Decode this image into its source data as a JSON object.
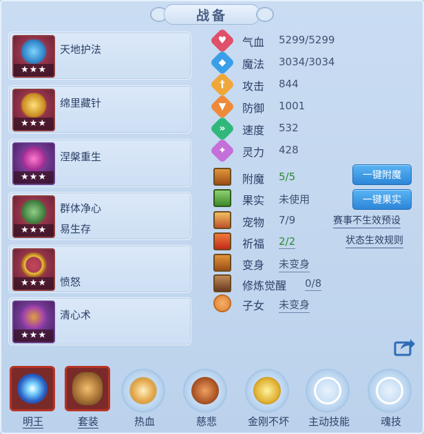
{
  "title": "战备",
  "skills": [
    {
      "name": "天地护法",
      "stars": "★★★",
      "icon": "dragon-icon",
      "color": "#3aa9e0"
    },
    {
      "name": "绵里藏针",
      "stars": "★★★",
      "icon": "treasure-icon",
      "color": "#d89a2a"
    },
    {
      "name": "涅槃重生",
      "stars": "★★★",
      "icon": "mask-icon",
      "color": "#c43aa0"
    },
    {
      "name": "群体净心",
      "name2": "易生存",
      "stars": "★★★",
      "icon": "beads-icon",
      "color": "#4d9a52"
    },
    {
      "name": "愤怒",
      "stars": "★★★",
      "icon": "ring-icon",
      "color": "#e0a030"
    },
    {
      "name": "清心术",
      "stars": "★★★",
      "icon": "robe-icon",
      "color": "#9a3ab0"
    }
  ],
  "stats": [
    {
      "label": "气血",
      "value": "5299/5299",
      "icon": "heart-icon",
      "color": "#e0506a",
      "glyph": "♥"
    },
    {
      "label": "魔法",
      "value": "3034/3034",
      "icon": "mana-icon",
      "color": "#3a9fe8",
      "glyph": "◆"
    },
    {
      "label": "攻击",
      "value": "844",
      "icon": "sword-icon",
      "color": "#f0a73a",
      "glyph": "†"
    },
    {
      "label": "防御",
      "value": "1001",
      "icon": "shield-icon",
      "color": "#ee8a3a",
      "glyph": "▼"
    },
    {
      "label": "速度",
      "value": "532",
      "icon": "speed-icon",
      "color": "#2fb87a",
      "glyph": "»"
    },
    {
      "label": "灵力",
      "value": "428",
      "icon": "spirit-icon",
      "color": "#c56fd8",
      "glyph": "✦"
    }
  ],
  "extras": [
    {
      "label": "附魔",
      "value": "5/5",
      "green": true,
      "underline": false,
      "icon": "enchant-icon"
    },
    {
      "label": "果实",
      "value": "未使用",
      "green": false,
      "underline": false,
      "icon": "fruit-icon"
    },
    {
      "label": "宠物",
      "value": "7/9",
      "green": false,
      "underline": false,
      "icon": "pet-icon"
    },
    {
      "label": "祈福",
      "value": "2/2",
      "green": true,
      "underline": true,
      "icon": "blessing-icon"
    },
    {
      "label": "变身",
      "value": "未变身",
      "green": false,
      "underline": true,
      "icon": "transform-icon"
    },
    {
      "label": "修炼觉醒",
      "value": "0/8",
      "green": false,
      "underline": true,
      "icon": "cultivation-icon"
    },
    {
      "label": "子女",
      "value": "未变身",
      "green": false,
      "underline": true,
      "icon": "children-icon"
    }
  ],
  "buttons": {
    "enchant": "一键附魔",
    "fruit": "一键果实"
  },
  "links": {
    "event_preset": "赛事不生效预设",
    "status_rule": "状态生效规则"
  },
  "bottom": [
    {
      "label": "明王",
      "type": "square",
      "underline": true,
      "icon": "sun-orb-icon"
    },
    {
      "label": "套装",
      "type": "square",
      "underline": true,
      "icon": "armor-icon"
    },
    {
      "label": "热血",
      "type": "round",
      "underline": false,
      "icon": "warrior-icon"
    },
    {
      "label": "慈悲",
      "type": "round",
      "underline": false,
      "icon": "scroll-icon"
    },
    {
      "label": "金刚不坏",
      "type": "round",
      "underline": false,
      "icon": "buddha-icon"
    },
    {
      "label": "主动技能",
      "type": "round-empty",
      "underline": false,
      "icon": "empty-slot-icon"
    },
    {
      "label": "魂技",
      "type": "round-empty",
      "underline": false,
      "icon": "empty-slot-icon"
    }
  ]
}
